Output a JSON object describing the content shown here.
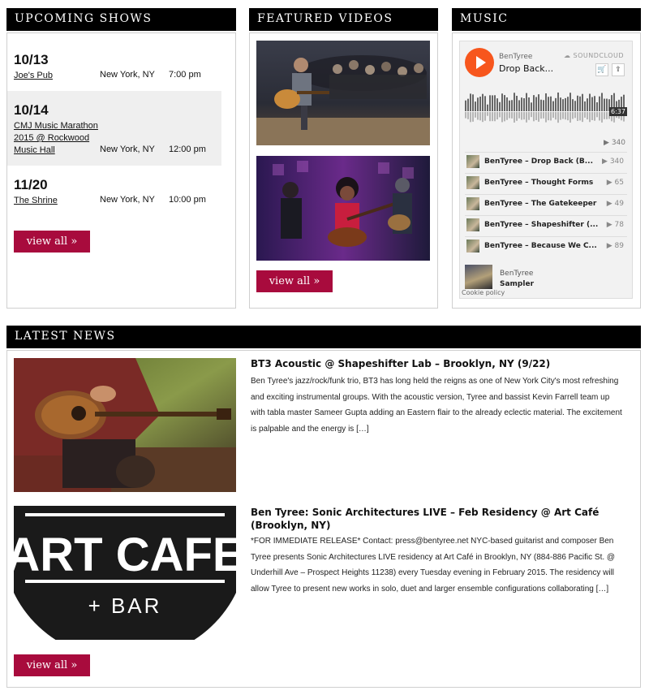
{
  "shows": {
    "header": "UPCOMING SHOWS",
    "items": [
      {
        "date": "10/13",
        "venue": "Joe's Pub",
        "city": "New York, NY",
        "time": "7:00 pm"
      },
      {
        "date": "10/14",
        "venue": "CMJ Music Marathon 2015 @ Rockwood Music Hall",
        "city": "New York, NY",
        "time": "12:00 pm"
      },
      {
        "date": "11/20",
        "venue": "The Shrine",
        "city": "New York, NY",
        "time": "10:00 pm"
      }
    ],
    "view_all": "view all »"
  },
  "videos": {
    "header": "FEATURED VIDEOS",
    "view_all": "view all »"
  },
  "music": {
    "header": "MUSIC",
    "widget": {
      "artist": "BenTyree",
      "title": "Drop Back...",
      "brand": "SOUNDCLOUD",
      "duration": "6:37",
      "plays": "▶ 340",
      "tracks": [
        {
          "name": "BenTyree – Drop Back (B...",
          "count": "▶ 340"
        },
        {
          "name": "BenTyree – Thought Forms",
          "count": "▶ 65"
        },
        {
          "name": "BenTyree – The Gatekeeper",
          "count": "▶ 49"
        },
        {
          "name": "BenTyree – Shapeshifter (...",
          "count": "▶ 78"
        },
        {
          "name": "BenTyree – Because We C...",
          "count": "▶ 89"
        }
      ],
      "footer_artist": "BenTyree",
      "footer_title": "Sampler",
      "cookie": "Cookie policy"
    }
  },
  "news": {
    "header": "LATEST NEWS",
    "items": [
      {
        "title": "BT3 Acoustic @ Shapeshifter Lab – Brooklyn, NY (9/22)",
        "body": "Ben Tyree's jazz/rock/funk trio, BT3 has long held the reigns as one of New York City's most refreshing and exciting instrumental groups. With the acoustic version, Tyree and bassist Kevin Farrell team up with tabla master Sameer Gupta adding an Eastern flair to the already eclectic material. The excitement is palpable and the energy is […]"
      },
      {
        "title": "Ben Tyree: Sonic Architectures LIVE – Feb Residency @ Art Café (Brooklyn, NY)",
        "body": "*FOR IMMEDIATE RELEASE* Contact: press@bentyree.net NYC-based guitarist and composer Ben Tyree presents Sonic Architectures LIVE residency at Art Café in Brooklyn, NY (884-886 Pacific St. @ Underhill Ave – Prospect Heights 11238) every Tuesday evening in February 2015. The residency will allow Tyree to present new works in solo, duet and larger ensemble configurations collaborating […]",
        "logo_line1": "ART CAFE",
        "logo_line2": "+ BAR"
      }
    ],
    "view_all": "view all »"
  }
}
